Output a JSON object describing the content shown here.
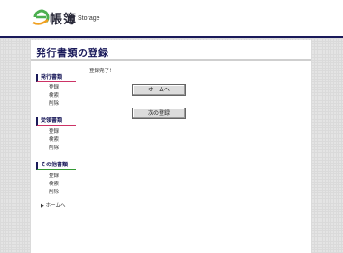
{
  "header": {
    "logo_title": "帳簿",
    "logo_sub": "Storage"
  },
  "page_title": "発行書類の登録",
  "nav": {
    "groups": [
      {
        "title": "発行書類",
        "items": [
          "登録",
          "検索",
          "削除"
        ]
      },
      {
        "title": "受領書類",
        "items": [
          "登録",
          "検索",
          "削除"
        ]
      },
      {
        "title": "その他書類",
        "items": [
          "登録",
          "検索",
          "削除"
        ]
      }
    ],
    "home_label": "ホームへ"
  },
  "main": {
    "message": "登録完了！",
    "home_button": "ホームへ",
    "next_button": "次の登録"
  },
  "colors": {
    "accent": "#1a1a5a",
    "rule_red": "#cc3366",
    "rule_green": "#339933",
    "logo_orange": "#f0a020",
    "logo_green": "#4caf50"
  }
}
